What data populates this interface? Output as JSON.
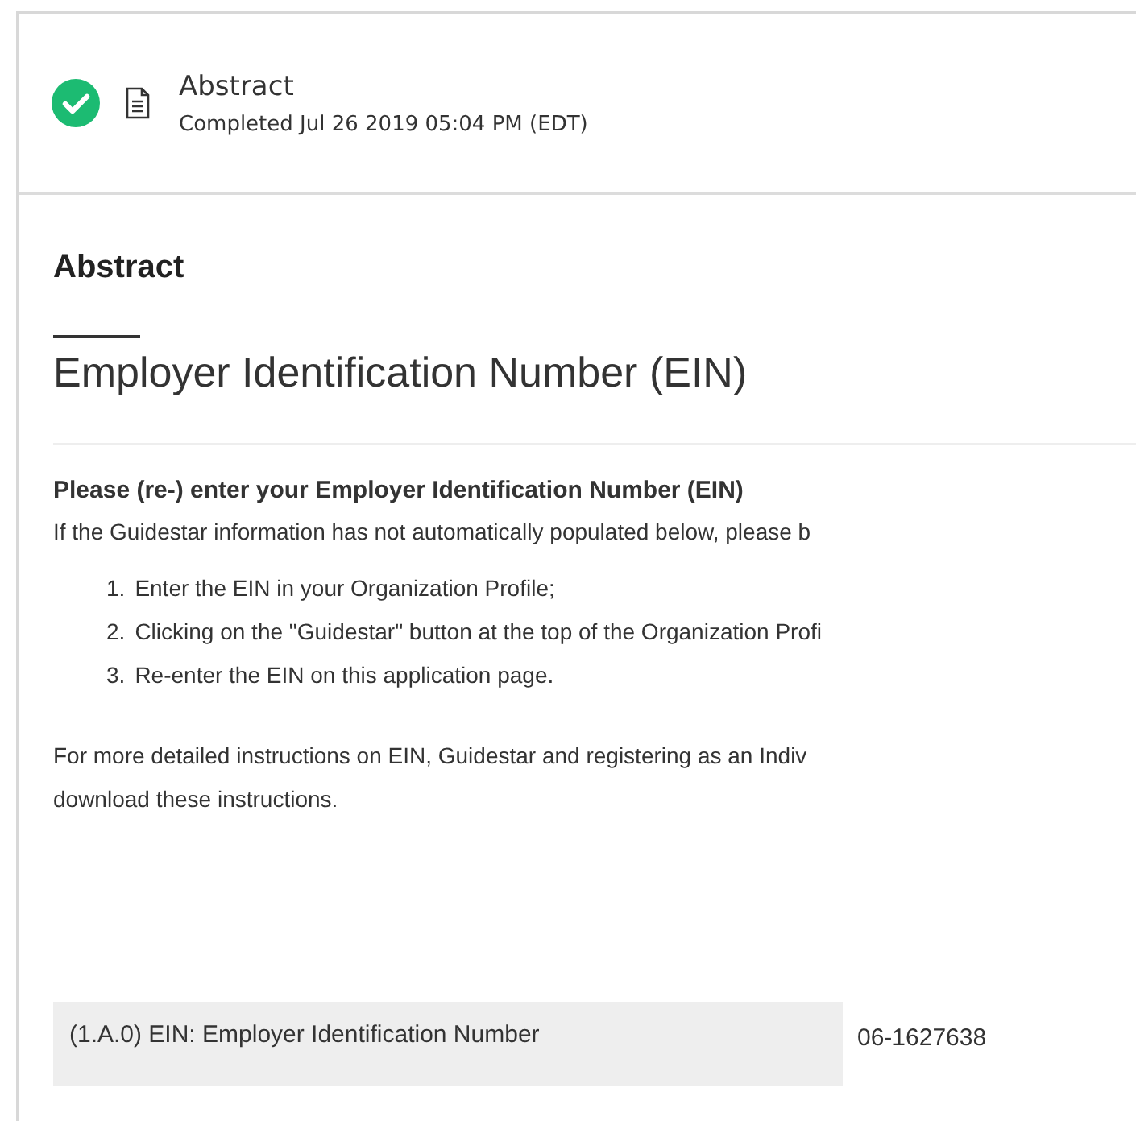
{
  "task": {
    "title": "Abstract",
    "completed": true,
    "subtitle": "Completed Jul 26 2019 05:04 PM (EDT)"
  },
  "section": {
    "heading": "Abstract",
    "title": "Employer Identification Number (EIN)"
  },
  "question": {
    "label": "Please (re-) enter your Employer Identification Number (EIN)",
    "intro": "If the Guidestar information has not automatically populated below, please b",
    "steps": [
      "Enter the EIN in your Organization Profile;",
      "Clicking on the \"Guidestar\" button at the top of the Organization Profi",
      "Re-enter the EIN on this application page."
    ],
    "step_numbers": [
      "1.",
      "2.",
      "3."
    ],
    "more_line_1": "For more detailed instructions on EIN, Guidestar and registering as an Indiv",
    "more_line_2": "download these instructions."
  },
  "fields": [
    {
      "label": "(1.A.0) EIN: Employer Identification Number",
      "value": "06-1627638"
    }
  ]
}
